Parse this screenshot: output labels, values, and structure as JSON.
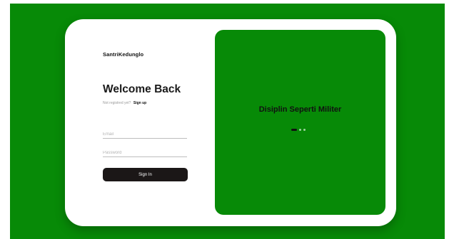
{
  "brand": "SantriKedunglo",
  "login": {
    "title": "Welcome Back",
    "prompt": "Not registred yet?",
    "signup_link": "Sign up",
    "email_placeholder": "Email",
    "password_placeholder": "Password",
    "submit_label": "Sign In"
  },
  "carousel": {
    "caption": "Disiplin Seperti Militer",
    "slide_count": 3,
    "active_slide": 1
  },
  "colors": {
    "background_green": "#078a07",
    "card": "#ffffff",
    "button": "#1b1717"
  }
}
